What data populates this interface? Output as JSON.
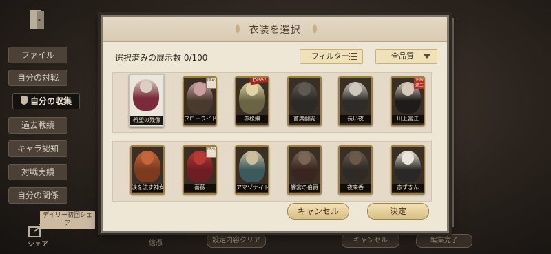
{
  "sidebar": {
    "items": [
      {
        "label": "ファイル"
      },
      {
        "label": "自分の対戦"
      },
      {
        "label": "自分の収集"
      },
      {
        "label": "過去戦績"
      },
      {
        "label": "キャラ認知"
      },
      {
        "label": "対戦実績"
      },
      {
        "label": "自分の関係"
      }
    ],
    "active_index": 2,
    "daily_tag": "デイリー初回シェア",
    "share_label": "シェア"
  },
  "background_bar": {
    "item1": "信憑",
    "btn1": "設定内容クリア",
    "btn2": "キャンセル",
    "btn3": "編集完了"
  },
  "modal": {
    "title": "衣装を選択",
    "count_text": "選択済みの展示数 0/100",
    "filter_label": "フィルター",
    "quality_label": "全品質",
    "cancel_label": "キャンセル",
    "ok_label": "決定",
    "cards": [
      {
        "name": "希望の残像",
        "art_color": "#7a2a3a",
        "head_color": "#d9cfc2",
        "selected": true,
        "tag": ""
      },
      {
        "name": "フローライド",
        "art_color": "#4a3a2e",
        "head_color": "#c99fa0",
        "selected": false,
        "tag": "限定"
      },
      {
        "name": "赤松編",
        "art_color": "#6a6444",
        "head_color": "#e0d3a6",
        "selected": false,
        "tag": "Design"
      },
      {
        "name": "首席翻閲",
        "art_color": "#2c2a26",
        "head_color": "#5e5a52",
        "selected": false,
        "tag": ""
      },
      {
        "name": "長い夜",
        "art_color": "#2e2c28",
        "head_color": "#cfc8be",
        "selected": false,
        "tag": ""
      },
      {
        "name": "川上富江",
        "art_color": "#1e1c1a",
        "head_color": "#d6cbbb",
        "selected": false,
        "tag": "伊藤潤二"
      },
      {
        "name": "涙を流す神女",
        "art_color": "#7c3a1e",
        "head_color": "#c5653a",
        "selected": false,
        "tag": ""
      },
      {
        "name": "薔薇",
        "art_color": "#6e1e22",
        "head_color": "#b83a33",
        "selected": false,
        "tag": "限定"
      },
      {
        "name": "アマゾナイト",
        "art_color": "#3c5a5e",
        "head_color": "#cdbf9e",
        "selected": false,
        "tag": ""
      },
      {
        "name": "饗宴の伯爵",
        "art_color": "#3a2620",
        "head_color": "#7a6655",
        "selected": false,
        "tag": ""
      },
      {
        "name": "夜来香",
        "art_color": "#2e2a26",
        "head_color": "#6a5a4c",
        "selected": false,
        "tag": ""
      },
      {
        "name": "赤ずきん",
        "art_color": "#2a2826",
        "head_color": "#ece4da",
        "selected": false,
        "tag": ""
      }
    ]
  },
  "colors": {
    "accent": "#d7bf86",
    "card_border": "#a07f3d",
    "panel": "#efe7d6"
  }
}
